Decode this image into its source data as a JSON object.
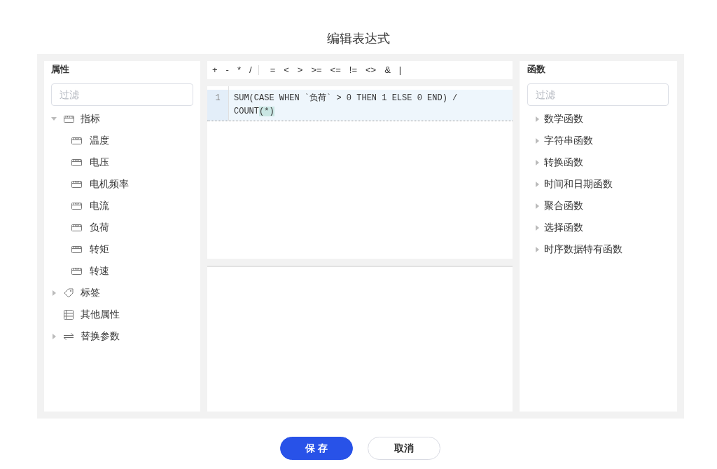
{
  "dialog": {
    "title": "编辑表达式"
  },
  "attributes_panel": {
    "title": "属性",
    "filter": {
      "placeholder": "过滤"
    },
    "tree": [
      {
        "label": "指标",
        "kind": "metric",
        "expanded": true,
        "children": [
          {
            "label": "温度",
            "kind": "metric"
          },
          {
            "label": "电压",
            "kind": "metric"
          },
          {
            "label": "电机频率",
            "kind": "metric"
          },
          {
            "label": "电流",
            "kind": "metric"
          },
          {
            "label": "负荷",
            "kind": "metric"
          },
          {
            "label": "转矩",
            "kind": "metric"
          },
          {
            "label": "转速",
            "kind": "metric"
          }
        ]
      },
      {
        "label": "标签",
        "kind": "tag",
        "expanded": false
      },
      {
        "label": "其他属性",
        "kind": "property"
      },
      {
        "label": "替换参数",
        "kind": "parameter",
        "expanded": false
      }
    ]
  },
  "operators": [
    [
      "+",
      "-",
      "*",
      "/"
    ],
    [
      "=",
      "<",
      ">",
      ">=",
      "<=",
      "!=",
      "<>",
      "&",
      "|"
    ]
  ],
  "editor": {
    "lines": [
      {
        "number": "1",
        "active": true,
        "segments": [
          {
            "text": "SUM(CASE WHEN `负荷` > 0 THEN 1 ELSE 0 END) / COUNT",
            "bracket_match": false
          },
          {
            "text": "(*)",
            "bracket_match": true
          }
        ]
      }
    ]
  },
  "functions_panel": {
    "title": "函数",
    "filter": {
      "placeholder": "过滤"
    },
    "categories": [
      {
        "label": "数学函数",
        "expanded": false
      },
      {
        "label": "字符串函数",
        "expanded": false
      },
      {
        "label": "转换函数",
        "expanded": false
      },
      {
        "label": "时间和日期函数",
        "expanded": false
      },
      {
        "label": "聚合函数",
        "expanded": false
      },
      {
        "label": "选择函数",
        "expanded": false
      },
      {
        "label": "时序数据特有函数",
        "expanded": false
      }
    ]
  },
  "buttons": [
    {
      "label": "保 存",
      "kind": "primary"
    },
    {
      "label": "取消",
      "kind": "secondary"
    }
  ]
}
